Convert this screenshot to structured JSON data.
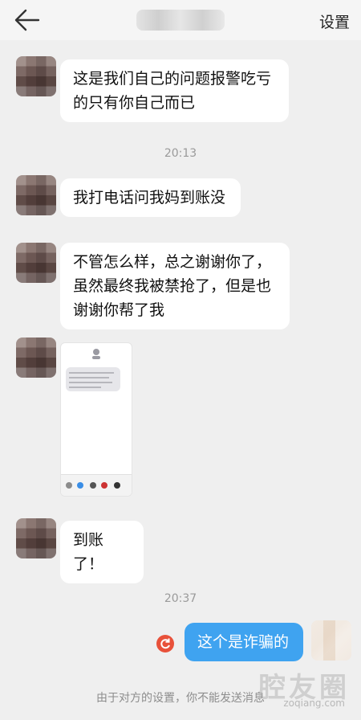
{
  "header": {
    "back_icon": "arrow-left-icon",
    "title": "",
    "settings_label": "设置"
  },
  "messages": [
    {
      "side": "left",
      "text": "这是我们自己的问题报警吃亏\n的只有你自己而已"
    },
    {
      "type": "time",
      "text": "20:13"
    },
    {
      "side": "left",
      "text": "我打电话问我妈到账没"
    },
    {
      "side": "left",
      "text": "不管怎么样，总之谢谢你了，\n虽然最终我被禁抢了，但是也\n谢谢你帮了我"
    },
    {
      "side": "left",
      "type": "image",
      "image_label": "screenshot-of-sms-conversation"
    },
    {
      "side": "left",
      "text": "到账了！"
    },
    {
      "type": "time",
      "text": "20:37"
    },
    {
      "side": "right",
      "text": "这个是诈骗的",
      "status_icon": "resend-error-icon",
      "status_color": "#e8513a"
    }
  ],
  "footer": {
    "notice": "由于对方的设置，你不能发送消息"
  },
  "watermark": {
    "logo_text": "腔友圈",
    "domain": "zoqiang.com"
  },
  "colors": {
    "background": "#efefef",
    "incoming_bubble": "#ffffff",
    "outgoing_bubble": "#3fa3f0",
    "timestamp_text": "#9a9a9a"
  }
}
